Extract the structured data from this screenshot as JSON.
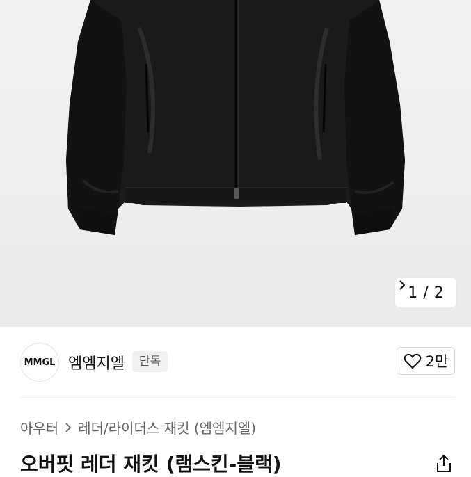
{
  "gallery": {
    "current": "1",
    "separator": "/",
    "total": "2",
    "image_alt": "black leather jacket"
  },
  "seller": {
    "logo_text": "MMGL",
    "name": "엠엠지엘",
    "badge": "단독"
  },
  "like": {
    "count": "2만"
  },
  "breadcrumb": {
    "level1": "아우터",
    "level2": "레더/라이더스 재킷 (엠엠지엘)"
  },
  "product": {
    "title": "오버핏 레더 재킷 (램스킨-블랙)"
  },
  "icons": {
    "next": "chevron-right-icon",
    "like": "heart-icon",
    "share": "share-icon"
  }
}
